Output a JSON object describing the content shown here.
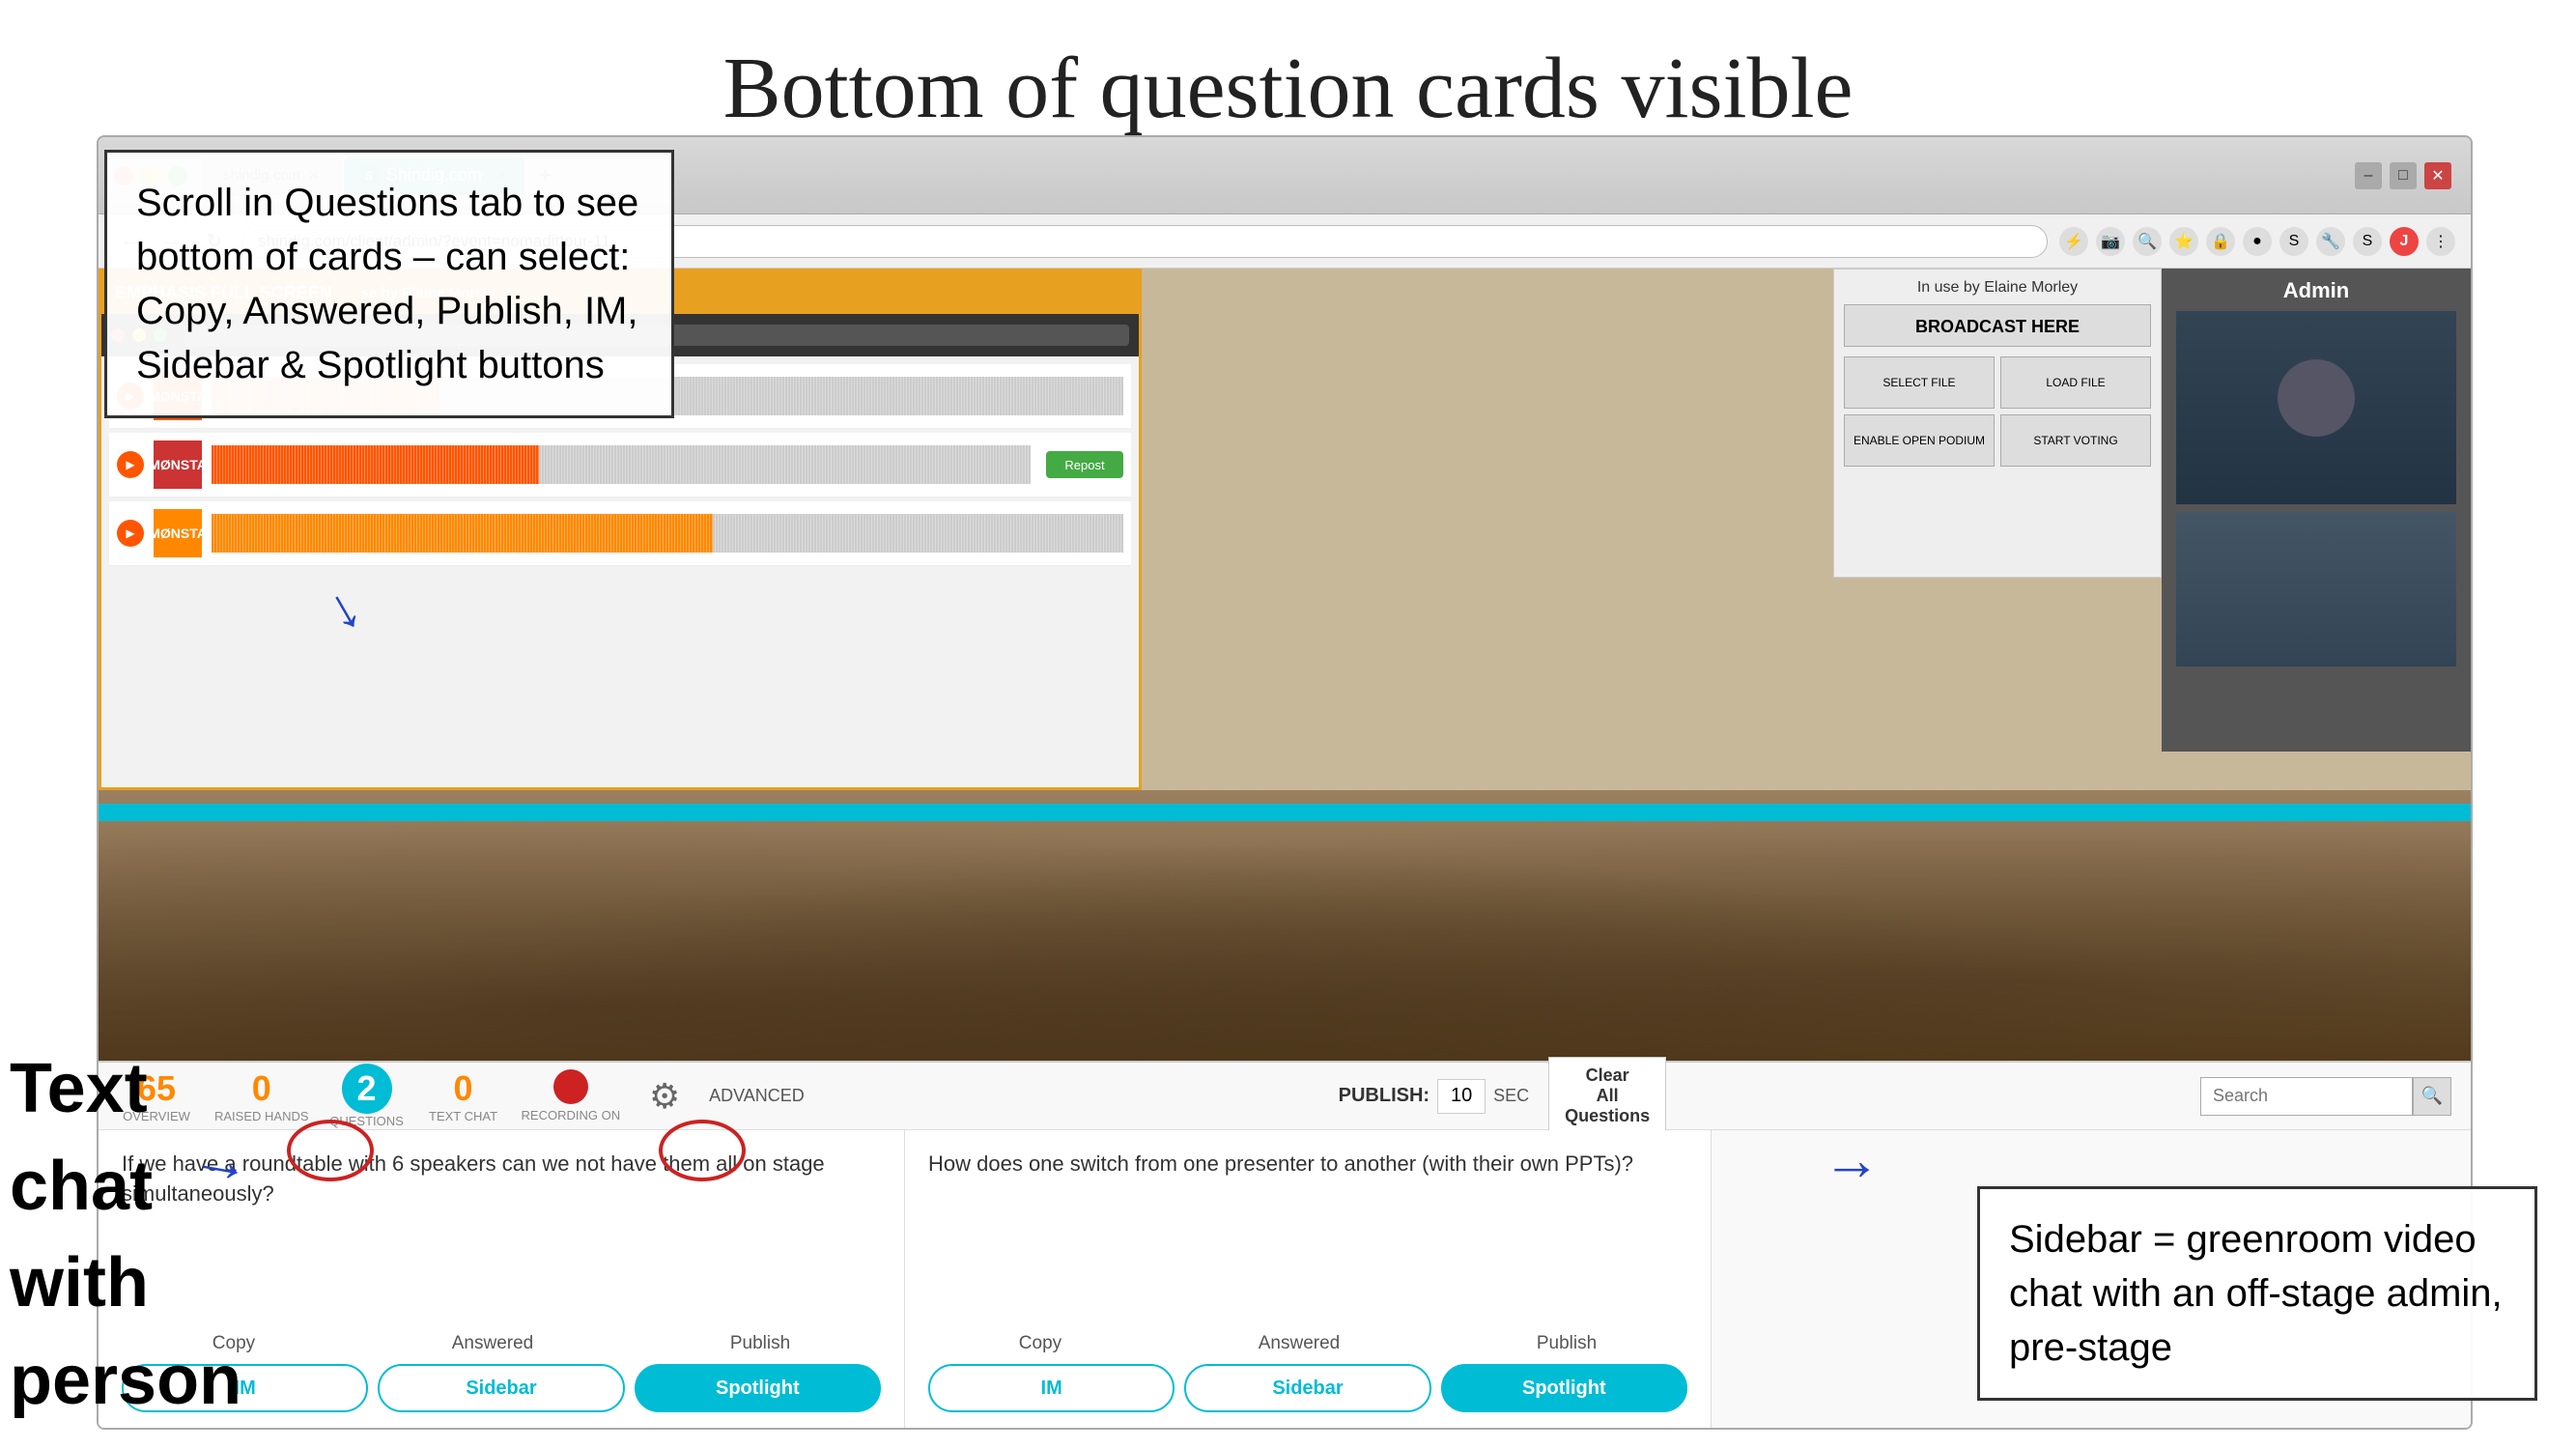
{
  "page": {
    "title": "Bottom of question cards visible"
  },
  "header": {
    "address": "shindig.com/client/admin/?event=nomadittour-11"
  },
  "second_browser": {
    "title": "Shindig.com"
  },
  "emphasis": {
    "label": "EMPHASIS FULL SCREEN",
    "subtitle": "se by Elaine Morley"
  },
  "admin": {
    "label": "Admin",
    "in_use": "In use by Elaine Morley",
    "broadcast_here": "BROADCAST HERE",
    "btn_select_file": "SELECT FILE",
    "btn_load_file": "LOAD FILE",
    "btn_enable_open_podium": "ENABLE OPEN PODIUM",
    "btn_start_voting": "START VOTING"
  },
  "annotation_left": {
    "text": "Scroll in Questions tab to see bottom of cards – can select: Copy, Answered, Publish, IM, Sidebar & Spotlight buttons"
  },
  "annotation_text_chat": {
    "text": "Text chat with person"
  },
  "annotation_sidebar": {
    "text": "Sidebar = greenroom video chat with an off-stage admin, pre-stage"
  },
  "toolbar": {
    "stats": [
      {
        "number": "65",
        "label": "OVERVIEW"
      },
      {
        "number": "0",
        "label": "RAISED HANDS"
      },
      {
        "number": "2",
        "label": "QUESTIONS",
        "active": true
      },
      {
        "number": "0",
        "label": "TEXT CHAT"
      }
    ],
    "recording": "RECORDING ON",
    "advanced": "ADVANCED",
    "publish_label": "PUBLISH:",
    "publish_num": "10",
    "sec_label": "SEC",
    "clear_line1": "Clear",
    "clear_line2": "All",
    "clear_line3": "Questions",
    "search_placeholder": "Search"
  },
  "questions": [
    {
      "text": "If we have a roundtable with 6 speakers can we not have them all on stage simultaneously?",
      "actions": [
        "Copy",
        "Answered",
        "Publish"
      ],
      "buttons": [
        "IM",
        "Sidebar",
        "Spotlight"
      ]
    },
    {
      "text": "How does one switch from one presenter to another (with their own PPTs)?",
      "actions": [
        "Copy",
        "Answered",
        "Publish"
      ],
      "buttons": [
        "IM",
        "Sidebar",
        "Spotlight"
      ]
    }
  ],
  "icons": {
    "gear": "⚙",
    "search": "🔍",
    "record": "●",
    "back": "←",
    "forward": "→",
    "refresh": "↻",
    "close": "✕",
    "minimize": "–",
    "maximize": "□"
  }
}
